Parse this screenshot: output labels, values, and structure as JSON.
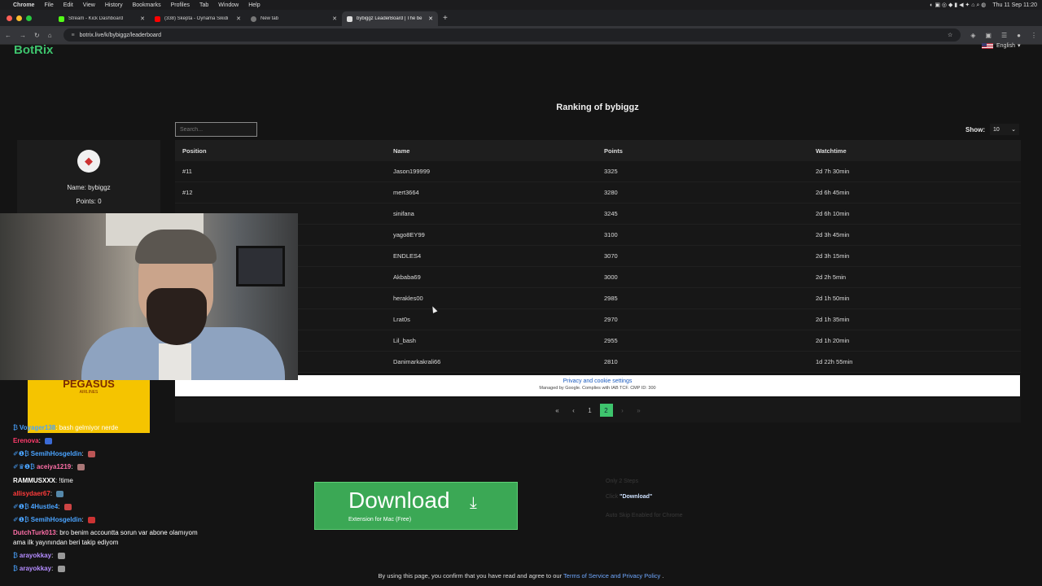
{
  "menubar": {
    "app": "Chrome",
    "items": [
      "File",
      "Edit",
      "View",
      "History",
      "Bookmarks",
      "Profiles",
      "Tab",
      "Window",
      "Help"
    ],
    "datetime": "Thu 11 Sep 11:20"
  },
  "tabs": [
    {
      "title": "Stream - Kick Dashboard",
      "color": "#53fc18"
    },
    {
      "title": "(338) Skepta - Oynama Sikidi",
      "color": "#ff0000"
    },
    {
      "title": "New tab",
      "color": "#888888"
    },
    {
      "title": "bybiggz LeaderBoard | The be",
      "color": "#dddddd"
    }
  ],
  "address": {
    "url": "botrix.live/k/bybiggz/leaderboard"
  },
  "site": {
    "logo": "BotRix",
    "language": "English",
    "title": "Ranking of bybiggz",
    "search_placeholder": "Search...",
    "show_label": "Show:",
    "show_value": "10"
  },
  "profile": {
    "name_text": "Name: bybiggz",
    "points_text": "Points: 0"
  },
  "table": {
    "headers": [
      "Position",
      "Name",
      "Points",
      "Watchtime"
    ],
    "rows": [
      {
        "position": "#11",
        "name": "Jason199999",
        "points": "3325",
        "watchtime": "2d 7h 30min"
      },
      {
        "position": "#12",
        "name": "mert3664",
        "points": "3280",
        "watchtime": "2d 6h 45min"
      },
      {
        "position": "",
        "name": "sinifana",
        "points": "3245",
        "watchtime": "2d 6h 10min"
      },
      {
        "position": "",
        "name": "yago8EY99",
        "points": "3100",
        "watchtime": "2d 3h 45min"
      },
      {
        "position": "",
        "name": "ENDLES4",
        "points": "3070",
        "watchtime": "2d 3h 15min"
      },
      {
        "position": "",
        "name": "Akbaba69",
        "points": "3000",
        "watchtime": "2d 2h 5min"
      },
      {
        "position": "",
        "name": "herakles00",
        "points": "2985",
        "watchtime": "2d 1h 50min"
      },
      {
        "position": "",
        "name": "Lrat0s",
        "points": "2970",
        "watchtime": "2d 1h 35min"
      },
      {
        "position": "",
        "name": "Lil_bash",
        "points": "2955",
        "watchtime": "2d 1h 20min"
      },
      {
        "position": "",
        "name": "Danimarkakrali66",
        "points": "2810",
        "watchtime": "1d 22h 55min"
      }
    ]
  },
  "cookie": {
    "link": "Privacy and cookie settings",
    "note": "Managed by Google. Complies with IAB TCF. CMP ID: 300"
  },
  "pager": {
    "pages": [
      "1",
      "2"
    ],
    "current": "2"
  },
  "ad": {
    "brand": "PEGASUS",
    "sub": "AIRLINES"
  },
  "chat": [
    {
      "user": "Voyager138",
      "text": "bash gelmiyor nerde",
      "color": "#4aa3ff"
    },
    {
      "user": "Erenova",
      "text": "",
      "color": "#ff3b6b"
    },
    {
      "user": "SemihHosgeldin",
      "text": "",
      "color": "#4aa3ff"
    },
    {
      "user": "aceiya1219",
      "text": "",
      "color": "#ff6fa8"
    },
    {
      "user": "RAMMUSXXX",
      "text": "!time",
      "color": "#ffffff"
    },
    {
      "user": "allisydaer67",
      "text": "",
      "color": "#ff3b3b"
    },
    {
      "user": "4Hustle4",
      "text": "",
      "color": "#4aa3ff"
    },
    {
      "user": "SemihHosgeldin",
      "text": "",
      "color": "#4aa3ff"
    },
    {
      "user": "DutchTurk013",
      "text": "bro benim accountta sorun var abone olamıyom",
      "text2": "ama ilk yayınından beri takip ediyom",
      "color": "#ff6fa8"
    },
    {
      "user": "arayokkay",
      "text": "",
      "color": "#b48cff"
    },
    {
      "user": "arayokkay",
      "text": "",
      "color": "#b48cff"
    }
  ],
  "download": {
    "label": "Download",
    "sub": "Extension for Mac (Free)"
  },
  "steps": {
    "title": "Only 2 Steps",
    "step1_prefix": "Click",
    "step1_link": "\"Download\"",
    "step2": "Auto Skip Enabled for Chrome"
  },
  "footer": {
    "prefix": "By using this page, you confirm that you have read and agree to our",
    "link": "Terms of Service and Privacy Policy",
    "suffix": "."
  }
}
